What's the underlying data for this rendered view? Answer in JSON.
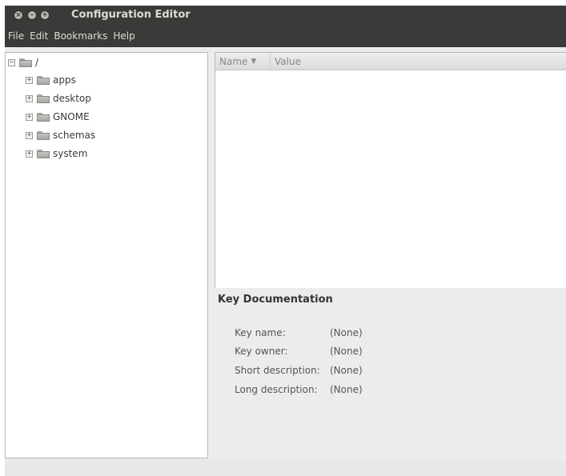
{
  "window": {
    "title": "Configuration Editor"
  },
  "menu": {
    "items": [
      "File",
      "Edit",
      "Bookmarks",
      "Help"
    ]
  },
  "tree": {
    "root": {
      "label": "/",
      "expander": "−"
    },
    "children": [
      {
        "label": "apps",
        "expander": "+"
      },
      {
        "label": "desktop",
        "expander": "+"
      },
      {
        "label": "GNOME",
        "expander": "+"
      },
      {
        "label": "schemas",
        "expander": "+"
      },
      {
        "label": "system",
        "expander": "+"
      }
    ]
  },
  "list": {
    "columns": [
      "Name",
      "Value"
    ],
    "sort_indicator": "▼"
  },
  "key_documentation": {
    "title": "Key Documentation",
    "rows": [
      {
        "label": "Key name:",
        "value": "(None)"
      },
      {
        "label": "Key owner:",
        "value": "(None)"
      },
      {
        "label": "Short description:",
        "value": "(None)"
      },
      {
        "label": "Long description:",
        "value": "(None)"
      }
    ]
  },
  "colors": {
    "titlebar_bg": "#3a3a38",
    "window_bg": "#ececec",
    "pane_bg": "#ffffff"
  },
  "icons": [
    "close-icon",
    "minimize-icon",
    "maximize-icon",
    "folder-icon",
    "sort-descending-icon"
  ]
}
